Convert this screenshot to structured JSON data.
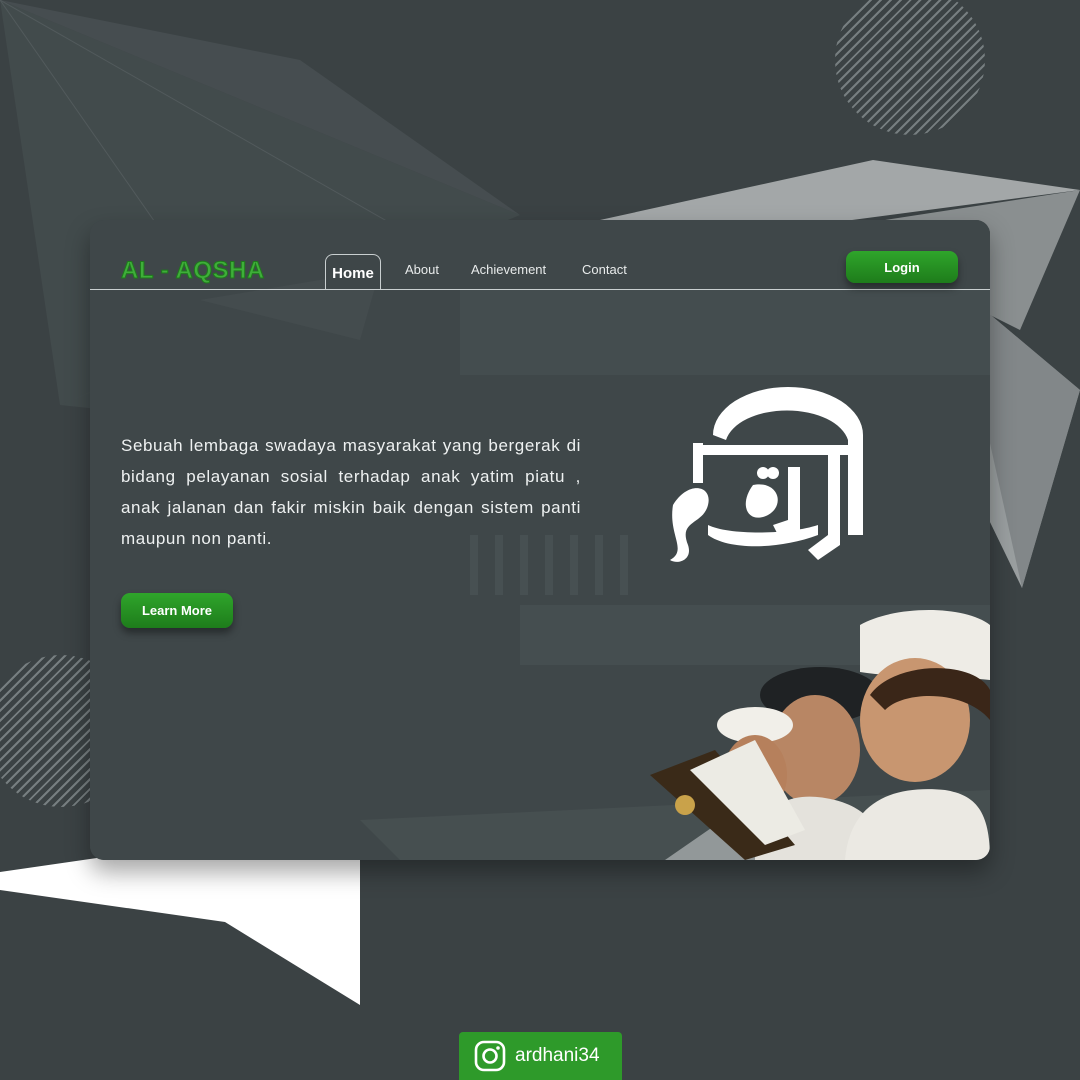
{
  "header": {
    "logo": "AL - AQSHA",
    "nav": [
      {
        "label": "Home",
        "active": true
      },
      {
        "label": "About"
      },
      {
        "label": "Achievement"
      },
      {
        "label": "Contact"
      }
    ],
    "login_label": "Login"
  },
  "hero": {
    "description": "Sebuah lembaga swadaya masyarakat yang bergerak di bidang pelayanan sosial terhadap anak yatim piatu , anak jalanan dan fakir miskin baik dengan sistem panti maupun non panti.",
    "cta_label": "Learn More"
  },
  "footer": {
    "instagram_handle": "ardhani34",
    "instagram_icon": "instagram-icon"
  },
  "colors": {
    "background": "#3b4244",
    "accent_green": "#2fa52b",
    "logo_green": "#3fae3a",
    "text": "#ffffff"
  }
}
